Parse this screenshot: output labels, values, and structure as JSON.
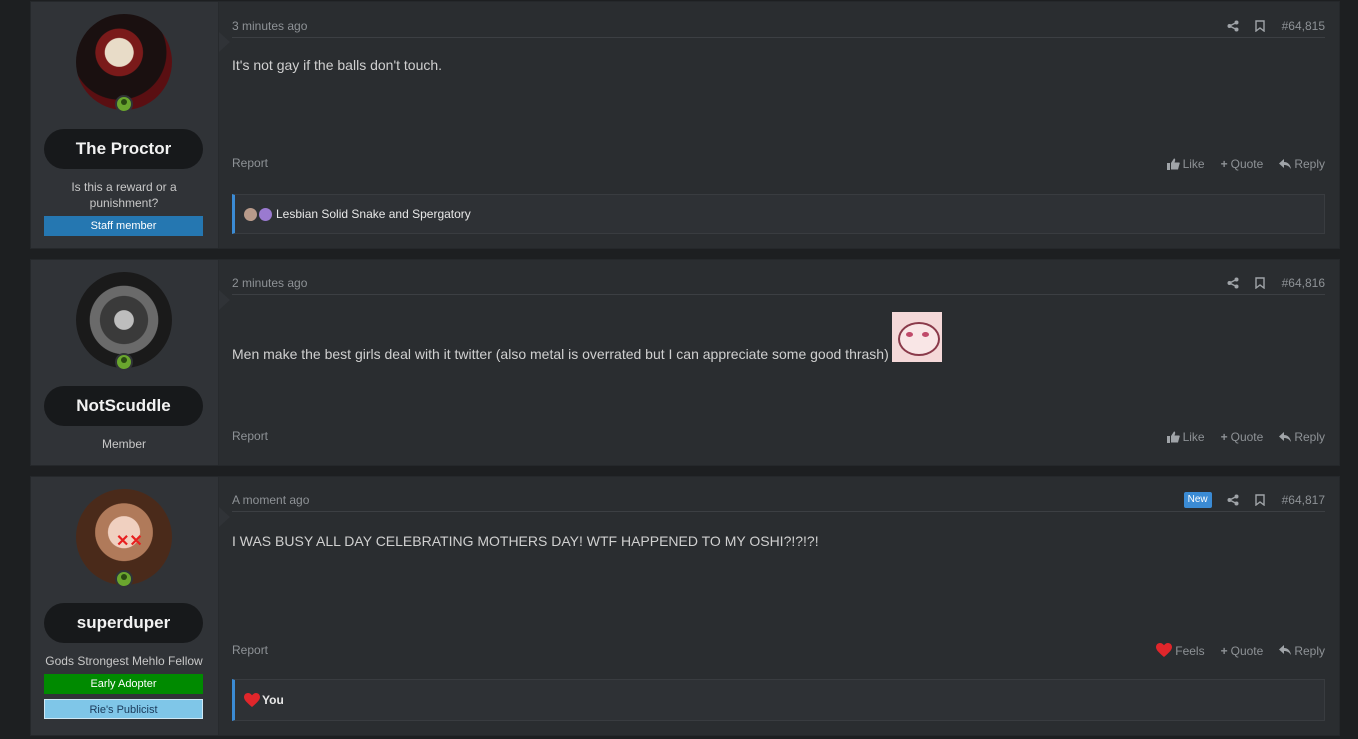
{
  "posts": [
    {
      "username": "The Proctor",
      "user_title": "Is this a reward or a punishment?",
      "banners": [
        {
          "label": "Staff member",
          "color": "#2577b1"
        }
      ],
      "time": "3 minutes ago",
      "post_number": "#64,815",
      "message": "It's not gay if the balls don't touch.",
      "report": "Report",
      "actions": [
        "Like",
        "Quote",
        "Reply"
      ],
      "reactions_text": "Lesbian Solid Snake and Spergatory"
    },
    {
      "username": "NotScuddle",
      "user_title": "Member",
      "banners": [],
      "time": "2 minutes ago",
      "post_number": "#64,816",
      "message": "Men make the best girls deal with it twitter (also metal is overrated but I can appreciate some good thrash)",
      "report": "Report",
      "actions": [
        "Like",
        "Quote",
        "Reply"
      ]
    },
    {
      "username": "superduper",
      "user_title": "Gods Strongest Mehlo Fellow",
      "banners": [
        {
          "label": "Early Adopter",
          "color": "#008a00"
        },
        {
          "label": "Rie's Publicist",
          "color": "#7fc6e8"
        }
      ],
      "time": "A moment ago",
      "new_badge": "New",
      "post_number": "#64,817",
      "message": "I WAS BUSY ALL DAY CELEBRATING MOTHERS DAY! WTF HAPPENED TO MY OSHI?!?!?!",
      "report": "Report",
      "actions": [
        "Feels",
        "Quote",
        "Reply"
      ],
      "reactions_text": "You"
    }
  ],
  "icons": {
    "share": "share-icon",
    "bookmark": "bookmark-icon",
    "like": "thumbs-up-icon",
    "quote": "plus-icon",
    "reply": "reply-icon",
    "feels": "heart-icon",
    "online": "online-indicator-icon"
  }
}
